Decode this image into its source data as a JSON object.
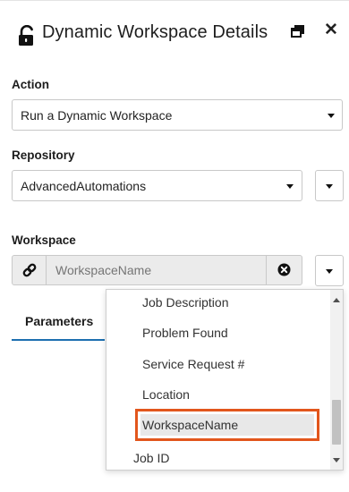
{
  "header": {
    "title": "Dynamic Workspace Details",
    "lock_icon": "unlocked-padlock-icon",
    "restore_icon": "restore-window-icon",
    "close_icon": "close-icon",
    "close_glyph": "✕"
  },
  "action": {
    "label": "Action",
    "selected": "Run a Dynamic Workspace"
  },
  "repository": {
    "label": "Repository",
    "selected": "AdvancedAutomations"
  },
  "workspace": {
    "label": "Workspace",
    "value": "",
    "placeholder": "WorkspaceName",
    "link_icon": "link-icon",
    "clear_icon": "clear-circle-x-icon"
  },
  "tabs": [
    {
      "label": "Parameters",
      "active": true
    }
  ],
  "dropdown": {
    "items": [
      {
        "label": "Job Description"
      },
      {
        "label": "Problem Found"
      },
      {
        "label": "Service Request #"
      },
      {
        "label": "Location"
      },
      {
        "label": "WorkspaceName",
        "highlighted": true
      },
      {
        "label": "Job ID"
      }
    ]
  },
  "colors": {
    "highlight_border": "#e2561c",
    "tab_underline": "#1d6fb0",
    "input_background": "#ebebeb"
  }
}
